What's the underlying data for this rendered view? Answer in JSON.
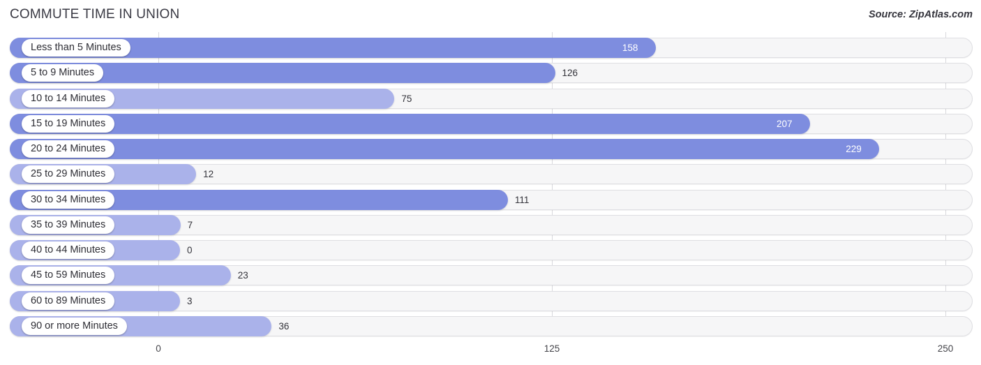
{
  "header": {
    "title": "COMMUTE TIME IN UNION",
    "source": "Source: ZipAtlas.com"
  },
  "colors": {
    "bar_dark": "#7e8ddf",
    "bar_light": "#aab2ea",
    "track": "#f6f6f7",
    "track_border": "#dedee2",
    "gridline": "#d8d8dc",
    "value_text_inside": "#ffffff",
    "value_text_outside": "#33333a",
    "title_text": "#3a3a44"
  },
  "chart_data": {
    "type": "bar",
    "orientation": "horizontal",
    "title": "COMMUTE TIME IN UNION",
    "xlabel": "",
    "ylabel": "",
    "xlim": [
      0,
      250
    ],
    "grid": true,
    "legend": false,
    "ticks": [
      {
        "label": "0",
        "value": 0
      },
      {
        "label": "125",
        "value": 125
      },
      {
        "label": "250",
        "value": 250
      }
    ],
    "categories": [
      "Less than 5 Minutes",
      "5 to 9 Minutes",
      "10 to 14 Minutes",
      "15 to 19 Minutes",
      "20 to 24 Minutes",
      "25 to 29 Minutes",
      "30 to 34 Minutes",
      "35 to 39 Minutes",
      "40 to 44 Minutes",
      "45 to 59 Minutes",
      "60 to 89 Minutes",
      "90 or more Minutes"
    ],
    "values": [
      158,
      126,
      75,
      207,
      229,
      12,
      111,
      7,
      0,
      23,
      3,
      36
    ],
    "value_labels": [
      "158",
      "126",
      "75",
      "207",
      "229",
      "12",
      "111",
      "7",
      "0",
      "23",
      "3",
      "36"
    ]
  }
}
